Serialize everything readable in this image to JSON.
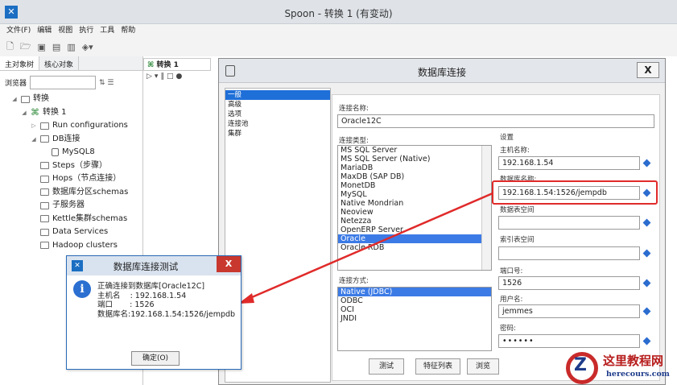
{
  "window": {
    "title": "Spoon - 转换 1 (有变动)",
    "app_icon": "pentaho-icon"
  },
  "menu": [
    "文件(F)",
    "编辑",
    "视图",
    "执行",
    "工具",
    "帮助"
  ],
  "left": {
    "tabs": [
      "主对象树",
      "核心对象"
    ],
    "search_label": "浏览器",
    "tree": [
      {
        "label": "转换",
        "level": 0,
        "expander": "◢",
        "icon": "folder"
      },
      {
        "label": "转换 1",
        "level": 1,
        "expander": "◢",
        "icon": "trans"
      },
      {
        "label": "Run configurations",
        "level": 2,
        "expander": "▷",
        "icon": "folder"
      },
      {
        "label": "DB连接",
        "level": 2,
        "expander": "◢",
        "icon": "folder"
      },
      {
        "label": "MySQL8",
        "level": 3,
        "expander": "",
        "icon": "db"
      },
      {
        "label": "Steps（步骤）",
        "level": 2,
        "expander": "",
        "icon": "folder"
      },
      {
        "label": "Hops（节点连接）",
        "level": 2,
        "expander": "",
        "icon": "folder"
      },
      {
        "label": "数据库分区schemas",
        "level": 2,
        "expander": "",
        "icon": "folder"
      },
      {
        "label": "子服务器",
        "level": 2,
        "expander": "",
        "icon": "folder"
      },
      {
        "label": "Kettle集群schemas",
        "level": 2,
        "expander": "",
        "icon": "folder"
      },
      {
        "label": "Data Services",
        "level": 2,
        "expander": "",
        "icon": "folder"
      },
      {
        "label": "Hadoop clusters",
        "level": 2,
        "expander": "",
        "icon": "folder"
      }
    ]
  },
  "canvas": {
    "tab": "转换 1"
  },
  "dialog": {
    "title": "数据库连接",
    "close": "X",
    "nav": [
      "一般",
      "高级",
      "选项",
      "连接池",
      "集群"
    ],
    "conn_name_label": "连接名称:",
    "conn_name_value": "Oracle12C",
    "conn_type_label": "连接类型:",
    "conn_types": [
      "MS SQL Server",
      "MS SQL Server (Native)",
      "MariaDB",
      "MaxDB (SAP DB)",
      "MonetDB",
      "MySQL",
      "Native Mondrian",
      "Neoview",
      "Netezza",
      "OpenERP Server",
      "Oracle",
      "Oracle RDB"
    ],
    "conn_type_selected": "Oracle",
    "access_label": "连接方式:",
    "access_methods": [
      "Native (JDBC)",
      "ODBC",
      "OCI",
      "JNDI"
    ],
    "access_selected": "Native (JDBC)",
    "settings_label": "设置",
    "host_label": "主机名称:",
    "host_value": "192.168.1.54",
    "dbname_label": "数据库名称:",
    "dbname_value": "192.168.1.54:1526/jempdb",
    "tablespace_label": "数据表空间",
    "index_ts_label": "索引表空间",
    "port_label": "端口号:",
    "port_value": "1526",
    "user_label": "用户名:",
    "user_value": "jemmes",
    "pwd_label": "密码:",
    "pwd_value": "••••••",
    "buttons": [
      "测试",
      "特征列表",
      "浏览"
    ]
  },
  "test_dialog": {
    "title": "数据库连接测试",
    "close": "X",
    "message": "正确连接到数据库[Oracle12C]\n主机名    : 192.168.1.54\n端口       : 1526\n数据库名:192.168.1.54:1526/jempdb",
    "ok": "确定(O)"
  },
  "watermark": {
    "text": "这里教程网",
    "url": "herecours.com"
  },
  "colors": {
    "highlight": "#e02a2a",
    "selection": "#3c7be6",
    "arrow": "#e02a2a"
  }
}
